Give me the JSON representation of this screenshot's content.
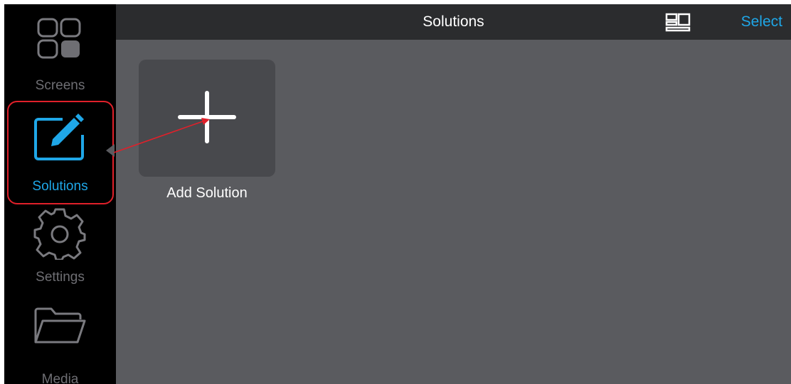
{
  "header": {
    "title": "Solutions",
    "select_label": "Select",
    "layout_icon": "layout-grid-icon"
  },
  "sidebar": {
    "items": [
      {
        "label": "Screens",
        "icon": "screens-grid-icon",
        "active": false
      },
      {
        "label": "Solutions",
        "icon": "edit-pencil-icon",
        "active": true
      },
      {
        "label": "Settings",
        "icon": "gear-icon",
        "active": false
      },
      {
        "label": "Media",
        "icon": "folder-icon",
        "active": false
      }
    ]
  },
  "main": {
    "add_tile": {
      "label": "Add Solution",
      "icon": "plus-icon"
    }
  },
  "colors": {
    "accent": "#1fa7e8",
    "annotation": "#e0202a",
    "sidebar_bg": "#000000",
    "content_bg": "#5a5b5f",
    "topbar_bg": "#2b2c2e"
  }
}
